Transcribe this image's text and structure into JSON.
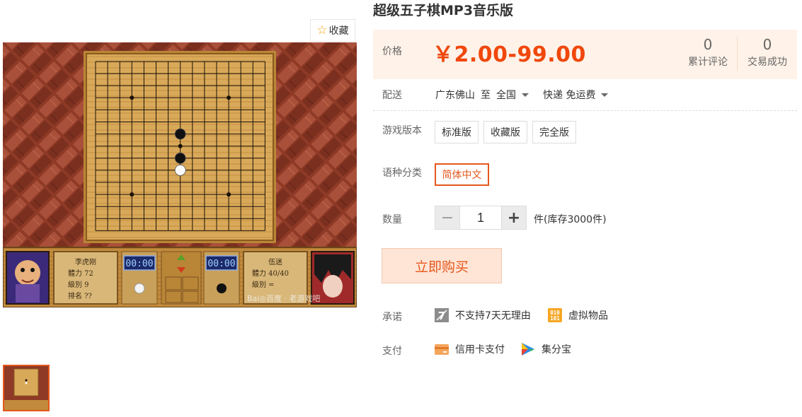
{
  "gallery": {
    "favorite_label": "收藏",
    "image_watermark": "Bai◎百度 · 老游戏吧",
    "game_panel": {
      "left_player": {
        "name": "李虎刚",
        "stamina": "體力  72",
        "rank": "級別  9",
        "place": "排名  ??"
      },
      "right_player": {
        "name": "伍迷",
        "stamina": "體力  40/40",
        "rank": "級別  ="
      },
      "left_timer": "00:00",
      "right_timer": "00:00"
    }
  },
  "product": {
    "title": "超级五子棋MP3音乐版",
    "price_label": "价格",
    "price": "￥2.00-99.00",
    "stats": [
      {
        "num": "0",
        "caption": "累计评论"
      },
      {
        "num": "0",
        "caption": "交易成功"
      }
    ],
    "shipping_label": "配送",
    "ship_from": "广东佛山",
    "ship_to_word": "至",
    "ship_to": "全国",
    "ship_method": "快递 免运费",
    "version_label": "游戏版本",
    "versions": [
      "标准版",
      "收藏版",
      "完全版"
    ],
    "language_label": "语种分类",
    "languages": [
      "简体中文"
    ],
    "quantity_label": "数量",
    "quantity_minus": "−",
    "quantity_value": "1",
    "quantity_plus": "+",
    "stock_text": "件(库存3000件)",
    "buy_button": "立即购买",
    "promise_label": "承诺",
    "promises": [
      "不支持7天无理由",
      "虚拟物品"
    ],
    "payment_label": "支付",
    "payments": [
      "信用卡支付",
      "集分宝"
    ]
  },
  "colors": {
    "accent": "#e4571c",
    "price": "#f0470b",
    "price_bg": "#fff2e8",
    "board": "#e0b565",
    "wall": "#9a3f2a"
  }
}
